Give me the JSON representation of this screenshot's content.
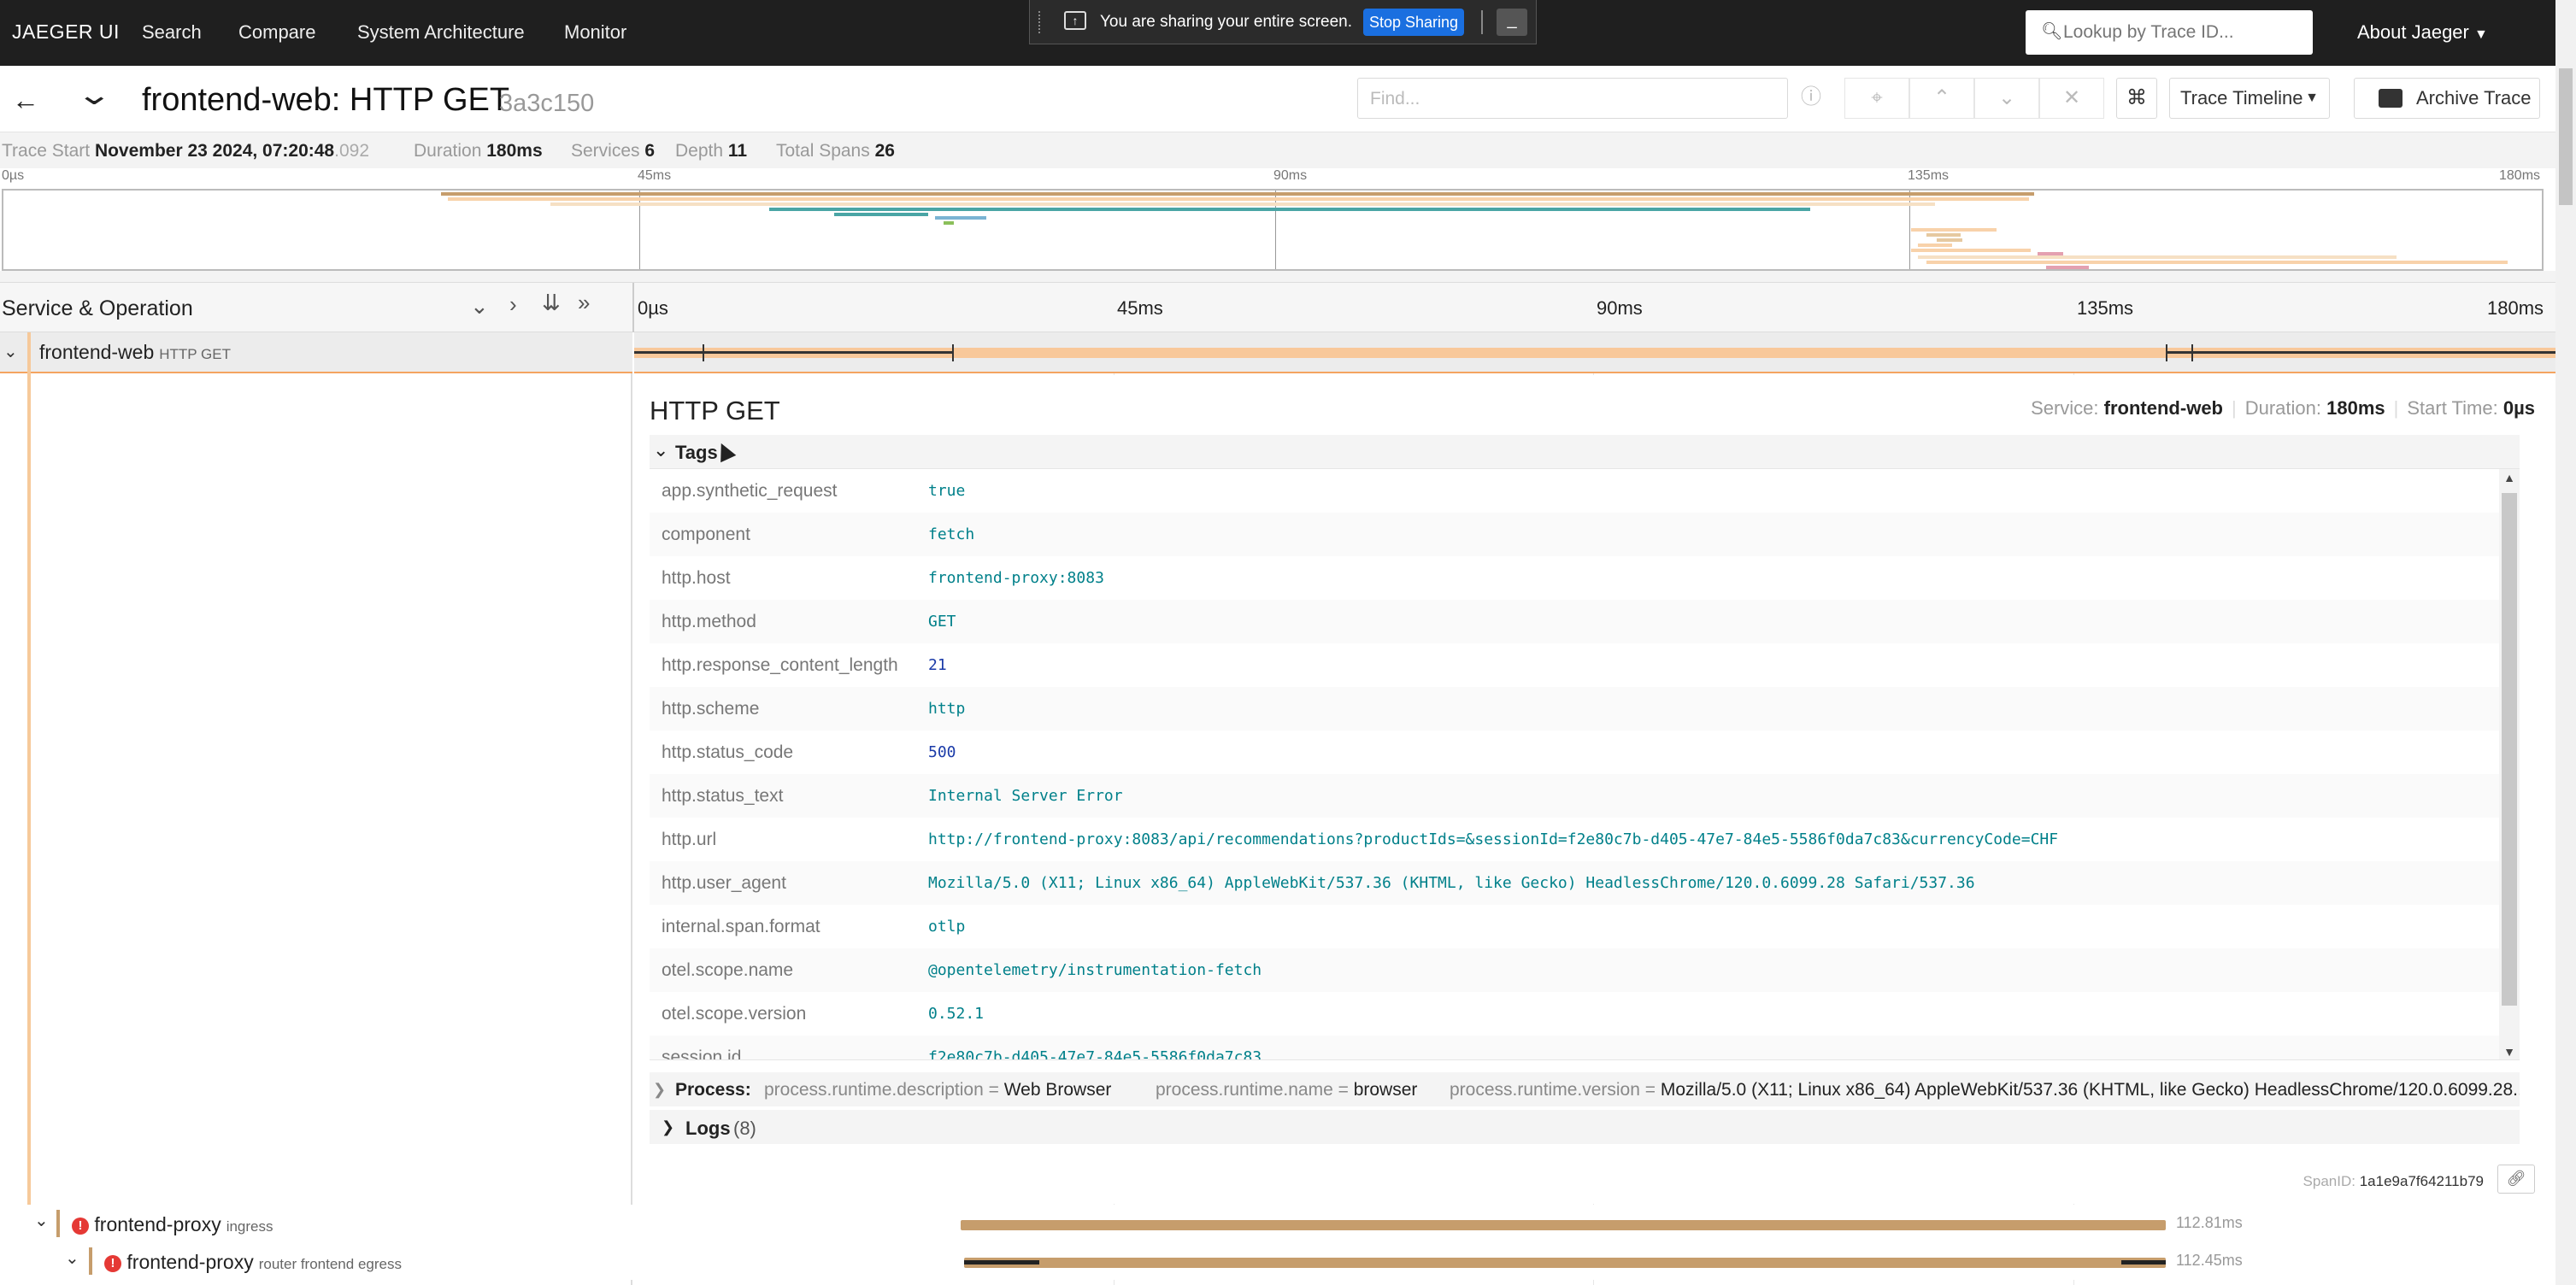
{
  "nav": {
    "brand": "JAEGER UI",
    "links": [
      "Search",
      "Compare",
      "System Architecture",
      "Monitor"
    ],
    "lookup_placeholder": "Lookup by Trace ID...",
    "about": "About Jaeger"
  },
  "share_bar": {
    "message": "You are sharing your entire screen.",
    "stop_label": "Stop Sharing",
    "hide_label": "_"
  },
  "trace": {
    "title": "frontend-web: HTTP GET",
    "id": "3a3c150",
    "find_placeholder": "Find...",
    "view_select": "Trace Timeline",
    "archive_label": "Archive Trace"
  },
  "summary": {
    "trace_start_label": "Trace Start",
    "trace_start_value": "November 23 2024, 07:20:48",
    "trace_start_ms": ".092",
    "duration_label": "Duration",
    "duration_value": "180ms",
    "services_label": "Services",
    "services_value": "6",
    "depth_label": "Depth",
    "depth_value": "11",
    "total_spans_label": "Total Spans",
    "total_spans_value": "26"
  },
  "minimap_ticks": [
    "0µs",
    "45ms",
    "90ms",
    "135ms",
    "180ms"
  ],
  "columns": {
    "service_operation": "Service & Operation",
    "ticks": [
      "0µs",
      "45ms",
      "90ms",
      "135ms",
      "180ms"
    ]
  },
  "root_span": {
    "service": "frontend-web",
    "operation": "HTTP GET"
  },
  "detail": {
    "operation": "HTTP GET",
    "service_label": "Service:",
    "service_value": "frontend-web",
    "duration_label": "Duration:",
    "duration_value": "180ms",
    "start_label": "Start Time:",
    "start_value": "0µs",
    "tags_label": "Tags",
    "tags": [
      {
        "key": "app.synthetic_request",
        "value": "true",
        "kind": "str"
      },
      {
        "key": "component",
        "value": "fetch",
        "kind": "str"
      },
      {
        "key": "http.host",
        "value": "frontend-proxy:8083",
        "kind": "str"
      },
      {
        "key": "http.method",
        "value": "GET",
        "kind": "str"
      },
      {
        "key": "http.response_content_length",
        "value": "21",
        "kind": "num"
      },
      {
        "key": "http.scheme",
        "value": "http",
        "kind": "str"
      },
      {
        "key": "http.status_code",
        "value": "500",
        "kind": "num"
      },
      {
        "key": "http.status_text",
        "value": "Internal Server Error",
        "kind": "str"
      },
      {
        "key": "http.url",
        "value": "http://frontend-proxy:8083/api/recommendations?productIds=&sessionId=f2e80c7b-d405-47e7-84e5-5586f0da7c83&currencyCode=CHF",
        "kind": "str"
      },
      {
        "key": "http.user_agent",
        "value": "Mozilla/5.0 (X11; Linux x86_64) AppleWebKit/537.36 (KHTML, like Gecko) HeadlessChrome/120.0.6099.28 Safari/537.36",
        "kind": "str"
      },
      {
        "key": "internal.span.format",
        "value": "otlp",
        "kind": "str"
      },
      {
        "key": "otel.scope.name",
        "value": "@opentelemetry/instrumentation-fetch",
        "kind": "str"
      },
      {
        "key": "otel.scope.version",
        "value": "0.52.1",
        "kind": "str"
      },
      {
        "key": "session.id",
        "value": "f2e80c7b-d405-47e7-84e5-5586f0da7c83",
        "kind": "str"
      }
    ],
    "process_label": "Process:",
    "process": [
      {
        "key": "process.runtime.description",
        "value": "Web Browser"
      },
      {
        "key": "process.runtime.name",
        "value": "browser"
      },
      {
        "key": "process.runtime.version",
        "value": "Mozilla/5.0 (X11; Linux x86_64) AppleWebKit/537.36 (KHTML, like Gecko) HeadlessChrome/120.0.6099.28..."
      }
    ],
    "logs_label": "Logs",
    "logs_count": "(8)",
    "span_id_label": "SpanID:",
    "span_id_value": "1a1e9a7f64211b79"
  },
  "child_spans": [
    {
      "service": "frontend-proxy",
      "operation": "ingress",
      "duration": "112.81ms",
      "error": true
    },
    {
      "service": "frontend-proxy",
      "operation": "router frontend egress",
      "duration": "112.45ms",
      "error": true
    }
  ],
  "colors": {
    "nav_bg": "#1f1f1f",
    "span_frontend_web": "#f8c89a",
    "span_frontend_proxy": "#c69d6c",
    "tag_value": "#00808a",
    "tag_number": "#1a3aa8",
    "error": "#e53935",
    "stop_sharing": "#1a6fe0"
  }
}
